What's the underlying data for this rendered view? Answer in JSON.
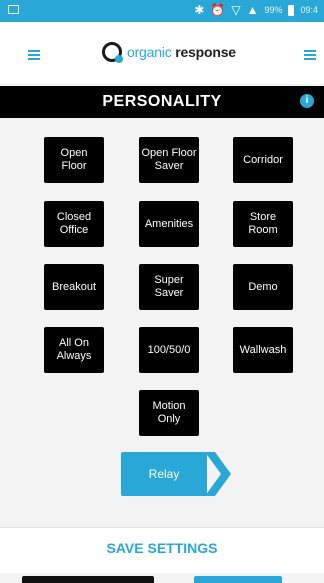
{
  "status_bar": {
    "battery": "99%",
    "time": "09:4"
  },
  "header": {
    "logo_brand": "organic",
    "logo_suffix": "response"
  },
  "personality": {
    "title": "PERSONALITY",
    "info_icon": "i"
  },
  "modes": [
    {
      "label": "Open\nFloor"
    },
    {
      "label": "Open Floor\nSaver"
    },
    {
      "label": "Corridor"
    },
    {
      "label": "Closed\nOffice"
    },
    {
      "label": "Amenities"
    },
    {
      "label": "Store\nRoom"
    },
    {
      "label": "Breakout"
    },
    {
      "label": "Super\nSaver"
    },
    {
      "label": "Demo"
    },
    {
      "label": "All On\nAlways"
    },
    {
      "label": "100/50/0"
    },
    {
      "label": "Wallwash"
    },
    {
      "label": "Motion\nOnly"
    }
  ],
  "relay": {
    "label": "Relay"
  },
  "save": {
    "label": "SAVE SETTINGS"
  },
  "colors": {
    "accent": "#29a8d7",
    "button": "#000000",
    "background": "#f3f3f3"
  },
  "icons": [
    "menu-icon",
    "signal-icon",
    "wifi-icon",
    "battery-icon",
    "alarm-icon",
    "bluetooth-icon",
    "info-icon",
    "chevron-right-icon"
  ]
}
